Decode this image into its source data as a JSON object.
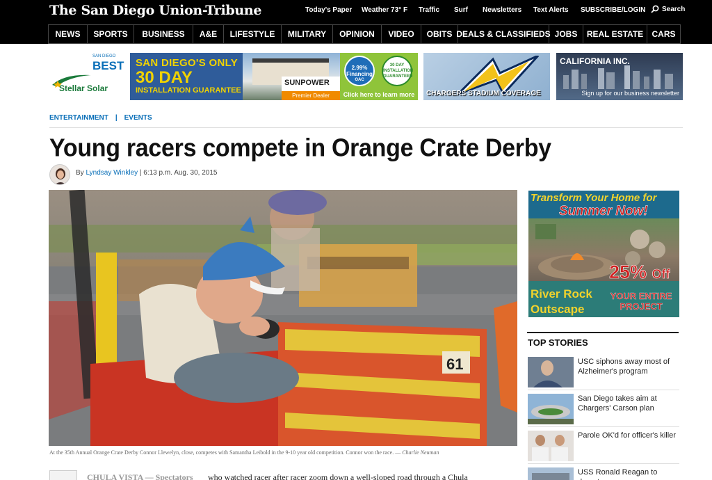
{
  "header": {
    "masthead": "The San Diego Union-Tribune",
    "util_links": [
      "Today's Paper",
      "Weather 73° F",
      "Traffic",
      "Surf",
      "Newsletters",
      "Text Alerts",
      "SUBSCRIBE/LOGIN"
    ],
    "search_label": "Search",
    "nav": [
      "NEWS",
      "SPORTS",
      "BUSINESS",
      "A&E",
      "LIFESTYLE",
      "MILITARY",
      "OPINION",
      "VIDEO",
      "OBITS",
      "DEALS & CLASSIFIEDS",
      "JOBS",
      "REAL ESTATE",
      "CARS"
    ]
  },
  "ads": {
    "solar": {
      "best_small": "SAN DIEGO",
      "best": "BEST",
      "brand": "Stellar Solar",
      "line1": "SAN DIEGO'S ONLY",
      "line2": "30 DAY",
      "line3": "INSTALLATION GUARANTEE",
      "sunpower": "SUNPOWER",
      "premier": "Premier Dealer",
      "financing_rate": "2.99%",
      "financing": "Financing",
      "financing_note": "OAC",
      "guarantee_top": "30 DAY",
      "guarantee_mid": "INSTALLATION",
      "guarantee_bottom": "GUARANTEED",
      "cta": "Click here to learn more"
    },
    "chargers": {
      "caption": "CHARGERS STADIUM COVERAGE"
    },
    "california": {
      "title": "CALIFORNIA INC.",
      "cta": "Sign up for our business newsletter"
    },
    "right": {
      "line1": "Transform Your Home for",
      "line2": "Summer Now!",
      "product_line1": "River Rock",
      "product_line2": "Outscape",
      "discount": "25%",
      "off": "Off",
      "offer_line1": "YOUR ENTIRE",
      "offer_line2": "PROJECT"
    }
  },
  "article": {
    "categories": [
      "ENTERTAINMENT",
      "EVENTS"
    ],
    "breadcrumb_separator": "|",
    "headline": "Young racers compete in Orange Crate Derby",
    "byline_prefix": "By",
    "author": "Lyndsay Winkley",
    "timestamp": "| 6:13 p.m. Aug. 30, 2015",
    "car_number": "61",
    "caption": "At the 35th Annual Orange Crate Derby Connor Llewelyn, close, competes with Samantha Leibold in the 9-10 year old competition. Connor won the race. —",
    "photo_credit": "Charlie Neuman",
    "dateline": "CHULA VISTA — Spectators",
    "body_start": "who watched racer after racer zoom down a well-sloped road through a Chula"
  },
  "top_stories": {
    "title": "TOP STORIES",
    "items": [
      {
        "title": "USC siphons away most of Alzheimer's program"
      },
      {
        "title": "San Diego takes aim at Chargers' Carson plan"
      },
      {
        "title": "Parole OK'd for officer's killer"
      },
      {
        "title": "USS Ronald Reagan to depart"
      }
    ]
  },
  "colors": {
    "link_blue": "#0a6fb8",
    "header_black": "#000000",
    "ad_blue": "#2f5c9a",
    "ad_yellow": "#f0d200"
  }
}
